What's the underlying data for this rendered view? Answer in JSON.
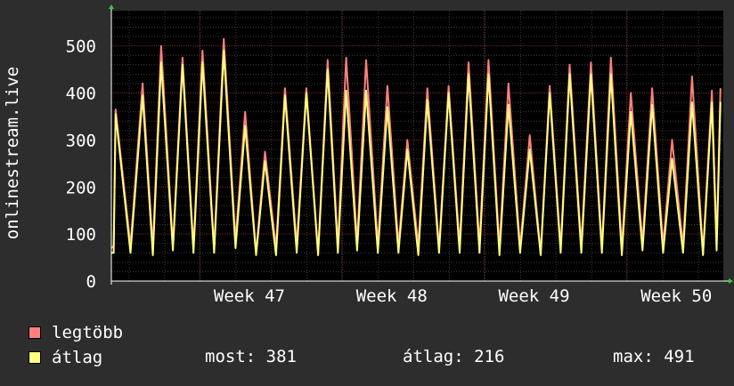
{
  "chart_data": {
    "type": "line",
    "ylabel": "onlinestream.live",
    "ylim": [
      0,
      575
    ],
    "yticks": [
      0,
      100,
      200,
      300,
      400,
      500
    ],
    "xlim": [
      0,
      4.3
    ],
    "x_ticks": [
      {
        "label": "Week 47",
        "x": 0.62
      },
      {
        "label": "Week 48",
        "x": 1.62
      },
      {
        "label": "Week 49",
        "x": 2.62
      },
      {
        "label": "Week 50",
        "x": 3.62
      }
    ],
    "grid": true,
    "series": [
      {
        "name": "legtöbb",
        "color": "#ff7f7f",
        "peaks_x": [
          0.0,
          0.03,
          0.22,
          0.35,
          0.5,
          0.64,
          0.79,
          0.94,
          1.08,
          1.22,
          1.37,
          1.52,
          1.65,
          1.79,
          1.94,
          2.08,
          2.22,
          2.37,
          2.51,
          2.65,
          2.79,
          2.94,
          3.08,
          3.22,
          3.37,
          3.51,
          3.65,
          3.8,
          3.94,
          4.08,
          4.22,
          4.28
        ],
        "peaks": [
          70,
          365,
          420,
          500,
          475,
          490,
          515,
          360,
          275,
          410,
          410,
          470,
          475,
          470,
          415,
          300,
          410,
          415,
          465,
          470,
          420,
          310,
          415,
          460,
          465,
          475,
          400,
          410,
          300,
          435,
          405,
          410
        ],
        "troughs": [
          75,
          75,
          70,
          75,
          70,
          70,
          85,
          60,
          70,
          75,
          60,
          75,
          80,
          75,
          75,
          75,
          70,
          75,
          75,
          70,
          70,
          60,
          70,
          75,
          70,
          70,
          80,
          75,
          75,
          60,
          80
        ]
      },
      {
        "name": "átlag",
        "color": "#ffff7f",
        "peaks_x": [
          0.0,
          0.03,
          0.22,
          0.35,
          0.5,
          0.64,
          0.79,
          0.94,
          1.08,
          1.22,
          1.37,
          1.52,
          1.65,
          1.79,
          1.94,
          2.08,
          2.22,
          2.37,
          2.51,
          2.65,
          2.79,
          2.94,
          3.08,
          3.22,
          3.37,
          3.51,
          3.65,
          3.8,
          3.94,
          4.08,
          4.22,
          4.28
        ],
        "peaks": [
          60,
          355,
          395,
          465,
          460,
          465,
          490,
          330,
          255,
          395,
          400,
          450,
          405,
          405,
          370,
          280,
          385,
          400,
          440,
          440,
          375,
          280,
          400,
          440,
          440,
          440,
          360,
          375,
          260,
          380,
          380,
          381
        ],
        "troughs": [
          60,
          60,
          55,
          65,
          60,
          60,
          70,
          55,
          55,
          60,
          55,
          60,
          65,
          60,
          60,
          55,
          60,
          60,
          60,
          55,
          60,
          55,
          60,
          60,
          60,
          55,
          65,
          60,
          60,
          55,
          65
        ]
      }
    ],
    "legend": [
      {
        "label": "legtöbb",
        "color": "#ff7f7f"
      },
      {
        "label": "átlag",
        "color": "#ffff7f"
      }
    ]
  },
  "stats": {
    "most": "most: 381",
    "atlag": "átlag: 216",
    "max": "max: 491"
  }
}
